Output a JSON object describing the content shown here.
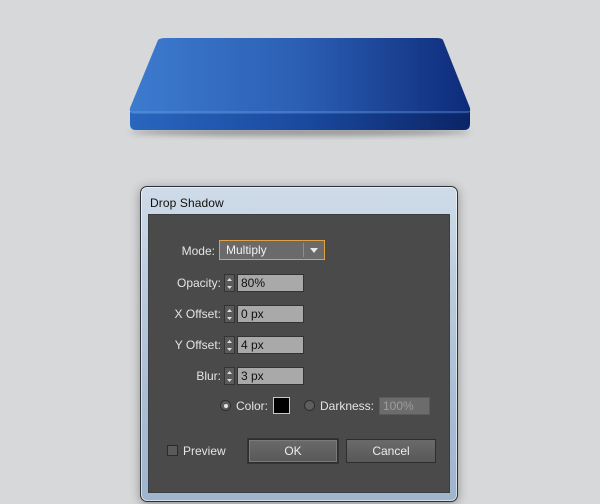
{
  "dialog": {
    "title": "Drop Shadow"
  },
  "mode": {
    "label": "Mode:",
    "value": "Multiply"
  },
  "opacity": {
    "label": "Opacity:",
    "value": "80%"
  },
  "x_offset": {
    "label": "X Offset:",
    "value": "0 px"
  },
  "y_offset": {
    "label": "Y Offset:",
    "value": "4 px"
  },
  "blur": {
    "label": "Blur:",
    "value": "3 px"
  },
  "color_option": {
    "label": "Color:",
    "selected": true,
    "swatch": "#000000"
  },
  "darkness_option": {
    "label": "Darkness:",
    "selected": false,
    "value": "100%"
  },
  "preview": {
    "label": "Preview",
    "checked": false
  },
  "buttons": {
    "ok": "OK",
    "cancel": "Cancel"
  },
  "colors": {
    "shape_light": "#3a76c9",
    "shape_dark": "#0d2a77",
    "panel": "#4a4a4a",
    "focus_border": "#e0a046"
  },
  "icons": {
    "dropdown": "chevron-down-icon",
    "stepper": "up-down-arrows-icon"
  }
}
